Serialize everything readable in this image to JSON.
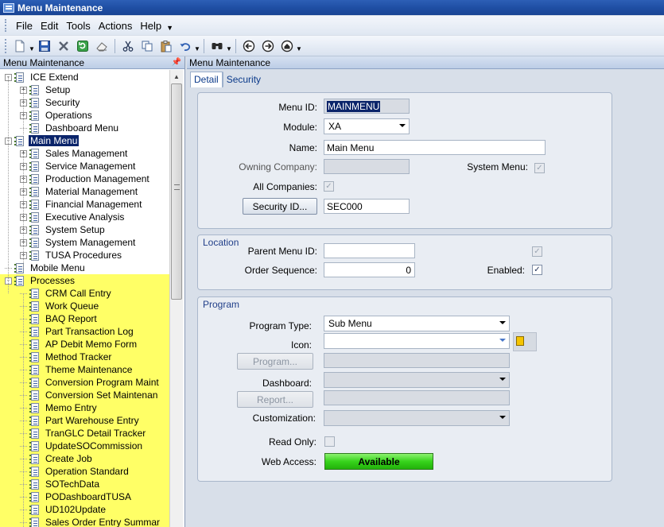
{
  "window": {
    "title": "Menu Maintenance"
  },
  "menubar": {
    "items": [
      "File",
      "Edit",
      "Tools",
      "Actions",
      "Help"
    ]
  },
  "left_panel": {
    "title": "Menu Maintenance",
    "tree": [
      {
        "label": "ICE Extend",
        "level": 0,
        "expander": "-"
      },
      {
        "label": "Setup",
        "level": 1,
        "expander": "+"
      },
      {
        "label": "Security",
        "level": 1,
        "expander": "+"
      },
      {
        "label": "Operations",
        "level": 1,
        "expander": "+"
      },
      {
        "label": "Dashboard Menu",
        "level": 1,
        "expander": ""
      },
      {
        "label": "Main Menu",
        "level": 0,
        "expander": "-",
        "selected": true
      },
      {
        "label": "Sales Management",
        "level": 1,
        "expander": "+"
      },
      {
        "label": "Service Management",
        "level": 1,
        "expander": "+"
      },
      {
        "label": "Production Management",
        "level": 1,
        "expander": "+"
      },
      {
        "label": "Material Management",
        "level": 1,
        "expander": "+"
      },
      {
        "label": "Financial Management",
        "level": 1,
        "expander": "+"
      },
      {
        "label": "Executive Analysis",
        "level": 1,
        "expander": "+"
      },
      {
        "label": "System Setup",
        "level": 1,
        "expander": "+"
      },
      {
        "label": "System Management",
        "level": 1,
        "expander": "+"
      },
      {
        "label": "TUSA Procedures",
        "level": 1,
        "expander": "+"
      },
      {
        "label": "Mobile Menu",
        "level": 0,
        "expander": ""
      },
      {
        "label": "Processes",
        "level": 0,
        "expander": "-",
        "highlight": true
      },
      {
        "label": "CRM Call Entry",
        "level": 1,
        "expander": "",
        "highlight": true
      },
      {
        "label": "Work Queue",
        "level": 1,
        "expander": "",
        "highlight": true
      },
      {
        "label": "BAQ Report",
        "level": 1,
        "expander": "",
        "highlight": true
      },
      {
        "label": "Part Transaction Log",
        "level": 1,
        "expander": "",
        "highlight": true
      },
      {
        "label": "AP Debit Memo Form",
        "level": 1,
        "expander": "",
        "highlight": true
      },
      {
        "label": "Method Tracker",
        "level": 1,
        "expander": "",
        "highlight": true
      },
      {
        "label": "Theme Maintenance",
        "level": 1,
        "expander": "",
        "highlight": true
      },
      {
        "label": "Conversion Program Maint",
        "level": 1,
        "expander": "",
        "highlight": true
      },
      {
        "label": "Conversion Set Maintenan",
        "level": 1,
        "expander": "",
        "highlight": true
      },
      {
        "label": "Memo Entry",
        "level": 1,
        "expander": "",
        "highlight": true
      },
      {
        "label": "Part Warehouse Entry",
        "level": 1,
        "expander": "",
        "highlight": true
      },
      {
        "label": "TranGLC Detail Tracker",
        "level": 1,
        "expander": "",
        "highlight": true
      },
      {
        "label": "UpdateSOCommission",
        "level": 1,
        "expander": "",
        "highlight": true
      },
      {
        "label": "Create Job",
        "level": 1,
        "expander": "",
        "highlight": true
      },
      {
        "label": "Operation Standard",
        "level": 1,
        "expander": "",
        "highlight": true
      },
      {
        "label": "SOTechData",
        "level": 1,
        "expander": "",
        "highlight": true
      },
      {
        "label": "PODashboardTUSA",
        "level": 1,
        "expander": "",
        "highlight": true
      },
      {
        "label": "UD102Update",
        "level": 1,
        "expander": "",
        "highlight": true
      },
      {
        "label": "Sales Order Entry Summar",
        "level": 1,
        "expander": "",
        "highlight": true
      }
    ]
  },
  "right_panel": {
    "title": "Menu Maintenance",
    "tabs": {
      "detail": "Detail",
      "security": "Security"
    },
    "detail": {
      "menu_id_label": "Menu ID:",
      "menu_id_value": "MAINMENU",
      "module_label": "Module:",
      "module_value": "XA",
      "name_label": "Name:",
      "name_value": "Main Menu",
      "owning_company_label": "Owning Company:",
      "owning_company_value": "",
      "system_menu_label": "System Menu:",
      "all_companies_label": "All Companies:",
      "security_id_button": "Security ID...",
      "security_id_value": "SEC000"
    },
    "location": {
      "title": "Location",
      "parent_menu_id_label": "Parent Menu ID:",
      "parent_menu_id_value": "",
      "order_sequence_label": "Order Sequence:",
      "order_sequence_value": "0",
      "enabled_label": "Enabled:"
    },
    "program": {
      "title": "Program",
      "program_type_label": "Program Type:",
      "program_type_value": "Sub Menu",
      "icon_label": "Icon:",
      "icon_value": "",
      "program_button": "Program...",
      "dashboard_label": "Dashboard:",
      "dashboard_value": "",
      "report_button": "Report...",
      "customization_label": "Customization:",
      "customization_value": "",
      "read_only_label": "Read Only:",
      "web_access_label": "Web Access:",
      "web_access_value": "Available"
    }
  },
  "check_mark": "✓"
}
